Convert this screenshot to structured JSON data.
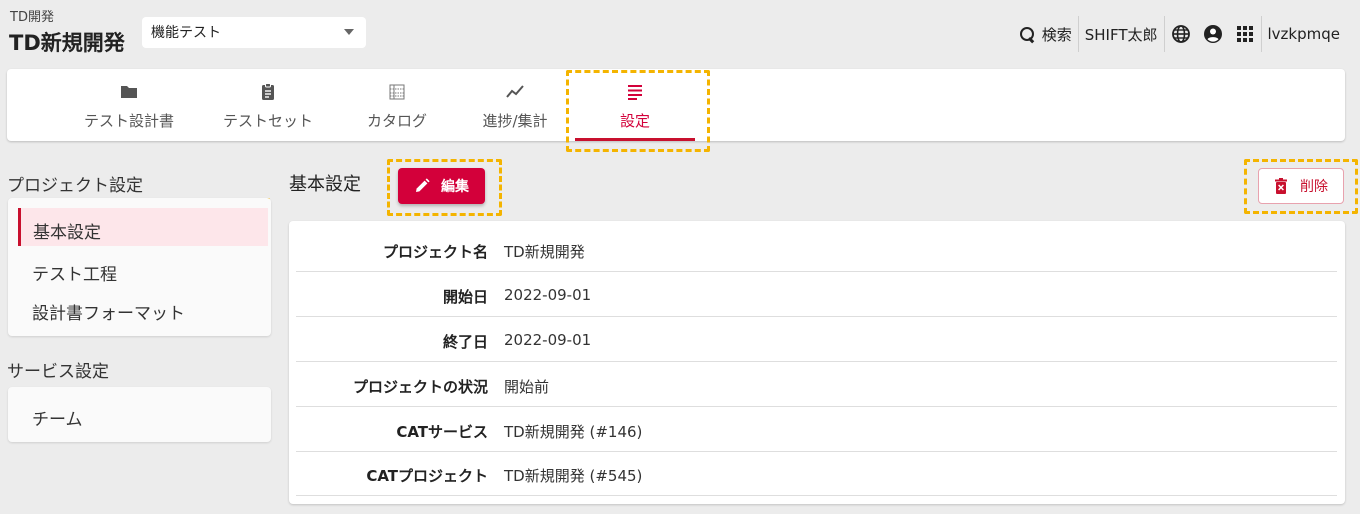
{
  "header": {
    "org": "TD開発",
    "project": "TD新規開発",
    "select_value": "機能テスト",
    "search_label": "検索",
    "user_name": "SHIFT太郎",
    "account": "lvzkpmqe"
  },
  "tabs": [
    {
      "label": "テスト設計書",
      "icon": "folder-icon"
    },
    {
      "label": "テストセット",
      "icon": "clipboard-icon"
    },
    {
      "label": "カタログ",
      "icon": "catalog-icon"
    },
    {
      "label": "進捗/集計",
      "icon": "trend-icon"
    },
    {
      "label": "設定",
      "icon": "settings-list-icon",
      "active": true
    }
  ],
  "sidebar": {
    "project_section": "プロジェクト設定",
    "project_items": [
      "基本設定",
      "テスト工程",
      "設計書フォーマット"
    ],
    "service_section": "サービス設定",
    "service_items": [
      "チーム"
    ]
  },
  "main": {
    "title": "基本設定",
    "edit_label": "編集",
    "delete_label": "削除",
    "rows": [
      {
        "label": "プロジェクト名",
        "value": "TD新規開発"
      },
      {
        "label": "開始日",
        "value": "2022-09-01"
      },
      {
        "label": "終了日",
        "value": "2022-09-01"
      },
      {
        "label": "プロジェクトの状況",
        "value": "開始前"
      },
      {
        "label": "CATサービス",
        "value": "TD新規開発 (#146)"
      },
      {
        "label": "CATプロジェクト",
        "value": "TD新規開発 (#545)"
      }
    ]
  },
  "colors": {
    "accent": "#d3003a",
    "highlight": "#f4b400",
    "active_bg": "#fde6ea"
  }
}
